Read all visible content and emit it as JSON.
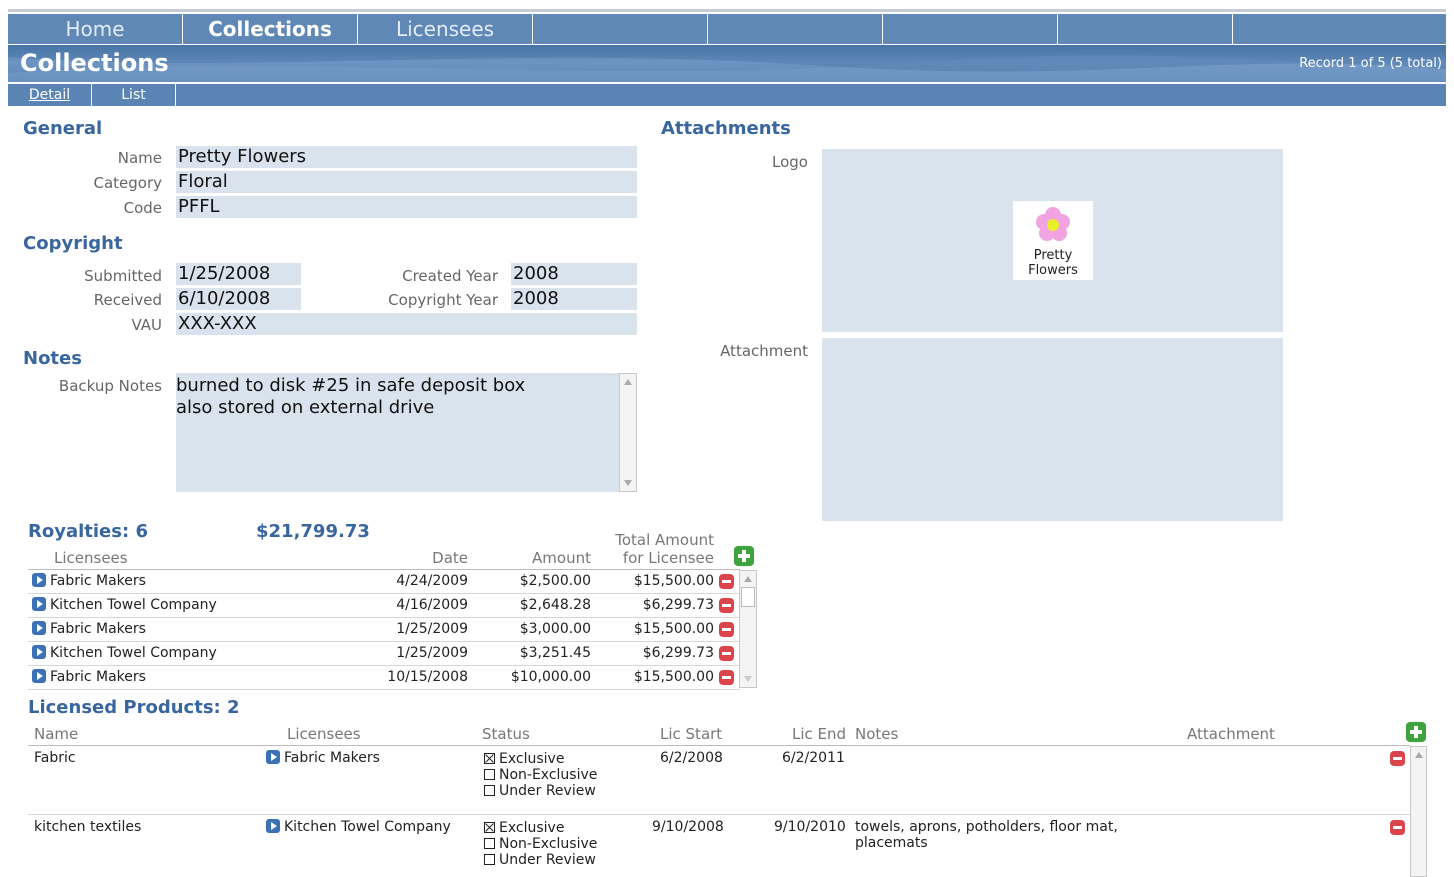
{
  "tabs": [
    "Home",
    "Collections",
    "Licensees",
    "",
    "",
    "",
    "",
    ""
  ],
  "active_tab": "Collections",
  "page_title": "Collections",
  "record_count": "Record 1 of 5 (5 total)",
  "subtabs": [
    "Detail",
    "List"
  ],
  "general": {
    "header": "General",
    "name_label": "Name",
    "name_value": "Pretty Flowers",
    "category_label": "Category",
    "category_value": "Floral",
    "code_label": "Code",
    "code_value": "PFFL"
  },
  "copyright": {
    "header": "Copyright",
    "submitted_label": "Submitted",
    "submitted_value": "1/25/2008",
    "received_label": "Received",
    "received_value": "6/10/2008",
    "vau_label": "VAU",
    "vau_value": "XXX-XXX",
    "created_year_label": "Created Year",
    "created_year_value": "2008",
    "copyright_year_label": "Copyright Year",
    "copyright_year_value": "2008"
  },
  "notes": {
    "header": "Notes",
    "backup_label": "Backup Notes",
    "line1": "burned to disk #25 in safe deposit box",
    "line2": "also stored on external drive"
  },
  "attachments": {
    "header": "Attachments",
    "logo_label": "Logo",
    "logo_text_1": "Pretty",
    "logo_text_2": "Flowers",
    "attachment_label": "Attachment"
  },
  "royalties": {
    "title": "Royalties:",
    "count": "6",
    "total": "$21,799.73",
    "col_licensees": "Licensees",
    "col_date": "Date",
    "col_amount": "Amount",
    "col_total_1": "Total Amount",
    "col_total_2": "for Licensee",
    "rows": [
      {
        "licensee": "Fabric Makers",
        "date": "4/24/2009",
        "amount": "$2,500.00",
        "total": "$15,500.00"
      },
      {
        "licensee": "Kitchen Towel Company",
        "date": "4/16/2009",
        "amount": "$2,648.28",
        "total": "$6,299.73"
      },
      {
        "licensee": "Fabric Makers",
        "date": "1/25/2009",
        "amount": "$3,000.00",
        "total": "$15,500.00"
      },
      {
        "licensee": "Kitchen Towel Company",
        "date": "1/25/2009",
        "amount": "$3,251.45",
        "total": "$6,299.73"
      },
      {
        "licensee": "Fabric Makers",
        "date": "10/15/2008",
        "amount": "$10,000.00",
        "total": "$15,500.00"
      }
    ]
  },
  "products": {
    "title": "Licensed Products:",
    "count": "2",
    "col_name": "Name",
    "col_licensees": "Licensees",
    "col_status": "Status",
    "col_lic_start": "Lic Start",
    "col_lic_end": "Lic End",
    "col_notes": "Notes",
    "col_attachment": "Attachment",
    "status_options": [
      "Exclusive",
      "Non-Exclusive",
      "Under Review"
    ],
    "rows": [
      {
        "name": "Fabric",
        "licensee": "Fabric Makers",
        "status": "Exclusive",
        "start": "6/2/2008",
        "end": "6/2/2011",
        "notes_1": "",
        "notes_2": ""
      },
      {
        "name": "kitchen textiles",
        "licensee": "Kitchen Towel Company",
        "status": "Exclusive",
        "start": "9/10/2008",
        "end": "9/10/2010",
        "notes_1": "towels, aprons, potholders, floor mat,",
        "notes_2": "placemats"
      }
    ]
  },
  "colors": {
    "tab_bar": "#5f88b6",
    "section_header": "#3a66a0",
    "field_bg": "#d9e3ed",
    "add_button": "#3fa33f",
    "delete_button": "#d9454a"
  }
}
